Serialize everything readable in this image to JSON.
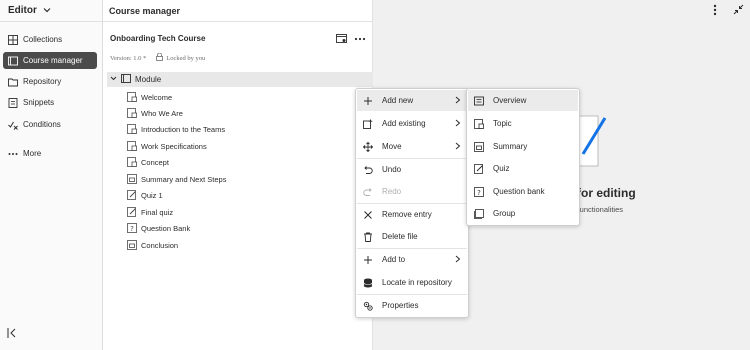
{
  "leftnav": {
    "title": "Editor",
    "items": [
      {
        "label": "Collections",
        "icon": "grid-icon"
      },
      {
        "label": "Course manager",
        "icon": "course-icon"
      },
      {
        "label": "Repository",
        "icon": "folder-icon"
      },
      {
        "label": "Snippets",
        "icon": "snippet-icon"
      },
      {
        "label": "Conditions",
        "icon": "conditions-icon"
      },
      {
        "label": "More",
        "icon": "more-icon"
      }
    ]
  },
  "course_manager": {
    "title": "Course manager",
    "course_name": "Onboarding Tech Course",
    "version": "Version: 1.0 *",
    "lock_status": "Locked by you",
    "module_label": "Module",
    "items": [
      {
        "label": "Welcome"
      },
      {
        "label": "Who We Are"
      },
      {
        "label": "Introduction to the Teams"
      },
      {
        "label": "Work Specifications"
      },
      {
        "label": "Concept"
      },
      {
        "label": "Summary and Next Steps"
      },
      {
        "label": "Quiz 1"
      },
      {
        "label": "Final quiz"
      },
      {
        "label": "Question Bank"
      },
      {
        "label": "Conclusion"
      }
    ]
  },
  "right_panel": {
    "title_partial": "for editing",
    "subtitle_partial": "r functionalities"
  },
  "context_menu": {
    "items": [
      {
        "label": "Add new",
        "icon": "plus-icon",
        "submenu": true
      },
      {
        "label": "Add existing",
        "icon": "add-existing-icon",
        "submenu": true
      },
      {
        "label": "Move",
        "icon": "move-icon",
        "submenu": true
      },
      {
        "label": "Undo",
        "icon": "undo-icon"
      },
      {
        "label": "Redo",
        "icon": "redo-icon",
        "disabled": true
      },
      {
        "label": "Remove entry",
        "icon": "close-icon"
      },
      {
        "label": "Delete file",
        "icon": "trash-icon"
      },
      {
        "label": "Add to",
        "icon": "plus-icon",
        "submenu": true
      },
      {
        "label": "Locate in repository",
        "icon": "database-icon"
      },
      {
        "label": "Properties",
        "icon": "properties-icon"
      }
    ]
  },
  "submenu": {
    "items": [
      {
        "label": "Overview",
        "icon": "overview-icon"
      },
      {
        "label": "Topic",
        "icon": "topic-icon"
      },
      {
        "label": "Summary",
        "icon": "summary-icon"
      },
      {
        "label": "Quiz",
        "icon": "quiz-icon"
      },
      {
        "label": "Question bank",
        "icon": "question-bank-icon"
      },
      {
        "label": "Group",
        "icon": "group-icon"
      }
    ]
  },
  "colors": {
    "active_nav_bg": "#4b4b4b",
    "accent_blue": "#1473e6"
  }
}
